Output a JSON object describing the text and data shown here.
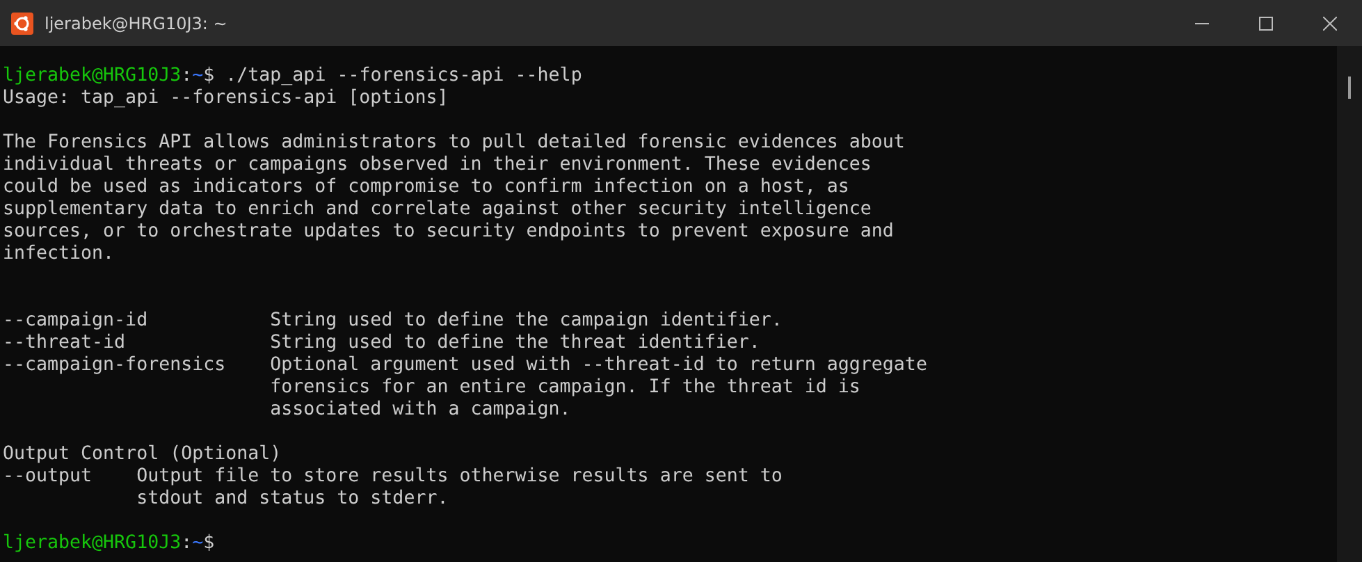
{
  "window": {
    "title": "ljerabek@HRG10J3: ~"
  },
  "terminal": [
    {
      "kind": "prompt",
      "user_host": "ljerabek@HRG10J3",
      "separator": ":",
      "path": "~",
      "symbol": "$",
      "command": "./tap_api --forensics-api --help"
    },
    {
      "kind": "text",
      "text": "Usage: tap_api --forensics-api [options]"
    },
    {
      "kind": "blank"
    },
    {
      "kind": "text",
      "text": "The Forensics API allows administrators to pull detailed forensic evidences about\nindividual threats or campaigns observed in their environment. These evidences\ncould be used as indicators of compromise to confirm infection on a host, as\nsupplementary data to enrich and correlate against other security intelligence\nsources, or to orchestrate updates to security endpoints to prevent exposure and\ninfection."
    },
    {
      "kind": "blank"
    },
    {
      "kind": "blank"
    },
    {
      "kind": "options",
      "options": [
        {
          "flag": "--campaign-id",
          "description": "String used to define the campaign identifier."
        },
        {
          "flag": "--threat-id",
          "description": "String used to define the threat identifier."
        },
        {
          "flag": "--campaign-forensics",
          "description": "Optional argument used with --threat-id to return aggregate\nforensics for an entire campaign. If the threat id is\nassociated with a campaign."
        }
      ]
    },
    {
      "kind": "blank"
    },
    {
      "kind": "text",
      "text": "Output Control (Optional)"
    },
    {
      "kind": "options",
      "options": [
        {
          "flag": "--output",
          "description": "Output file to store results otherwise results are sent to\nstdout and status to stderr."
        }
      ]
    },
    {
      "kind": "blank"
    },
    {
      "kind": "prompt",
      "user_host": "ljerabek@HRG10J3",
      "separator": ":",
      "path": "~",
      "symbol": "$"
    }
  ]
}
